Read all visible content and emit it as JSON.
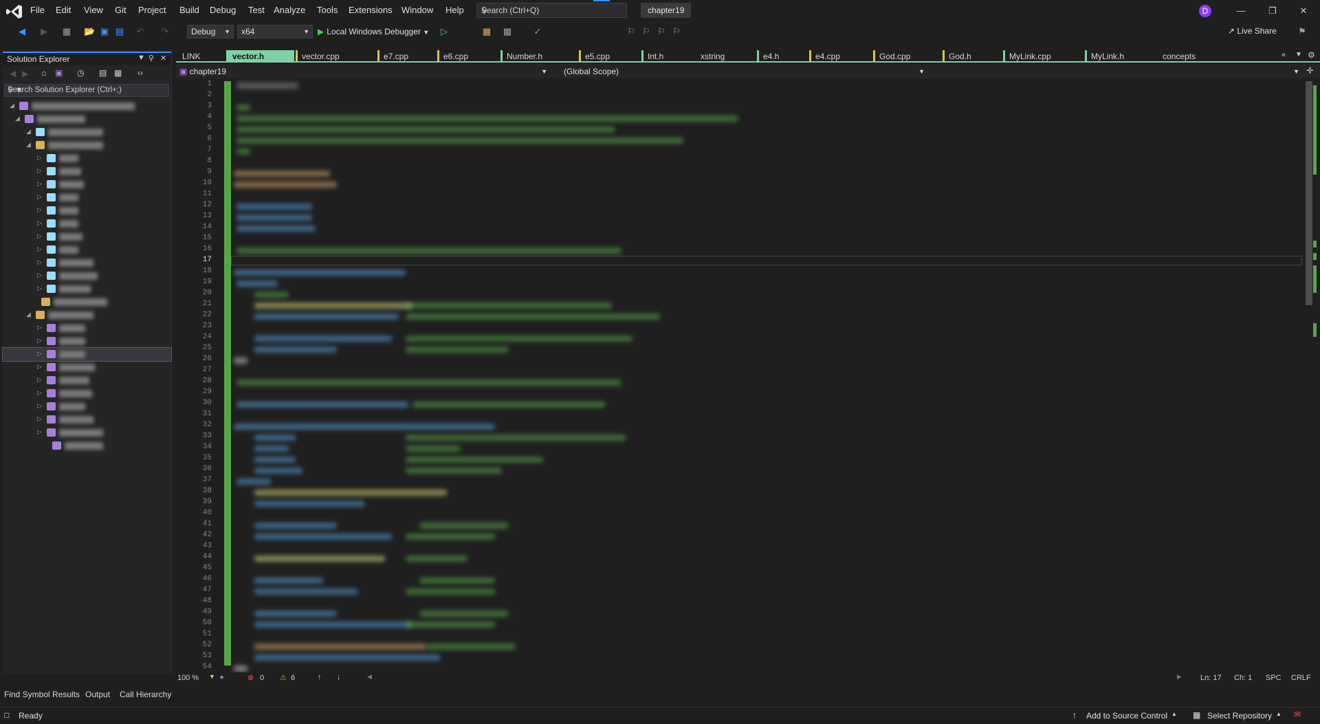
{
  "menu": [
    "File",
    "Edit",
    "View",
    "Git",
    "Project",
    "Build",
    "Debug",
    "Test",
    "Analyze",
    "Tools",
    "Extensions",
    "Window",
    "Help"
  ],
  "search": {
    "placeholder": "Search (Ctrl+Q)"
  },
  "solution_name": "chapter19",
  "user_initial": "D",
  "toolbar": {
    "config": "Debug",
    "platform": "x64",
    "debugger": "Local Windows Debugger",
    "live_share": "Live Share"
  },
  "solution_explorer": {
    "title": "Solution Explorer",
    "search_placeholder": "Search Solution Explorer (Ctrl+;)"
  },
  "tabs": [
    "LINK",
    "vector.h",
    "vector.cpp",
    "e7.cpp",
    "e6.cpp",
    "Number.h",
    "e5.cpp",
    "Int.h",
    "xstring",
    "e4.h",
    "e4.cpp",
    "God.cpp",
    "God.h",
    "MyLink.cpp",
    "MyLink.h",
    "concepts"
  ],
  "active_tab": "vector.h",
  "nav": {
    "project": "chapter19",
    "scope": "(Global Scope)"
  },
  "editor_status": {
    "zoom": "100 %",
    "errors": "0",
    "warnings": "6",
    "line": "Ln: 17",
    "col": "Ch: 1",
    "spacing": "SPC",
    "eol": "CRLF"
  },
  "bottom_tabs": [
    "Find Symbol Results",
    "Output",
    "Call Hierarchy"
  ],
  "status": {
    "ready": "Ready",
    "source_control": "Add to Source Control",
    "repository": "Select Repository"
  },
  "colors": {
    "accent": "#3794ff",
    "active_tab": "#7fd1a5",
    "change_bar": "#57a64a",
    "avatar": "#8a3ffc"
  }
}
